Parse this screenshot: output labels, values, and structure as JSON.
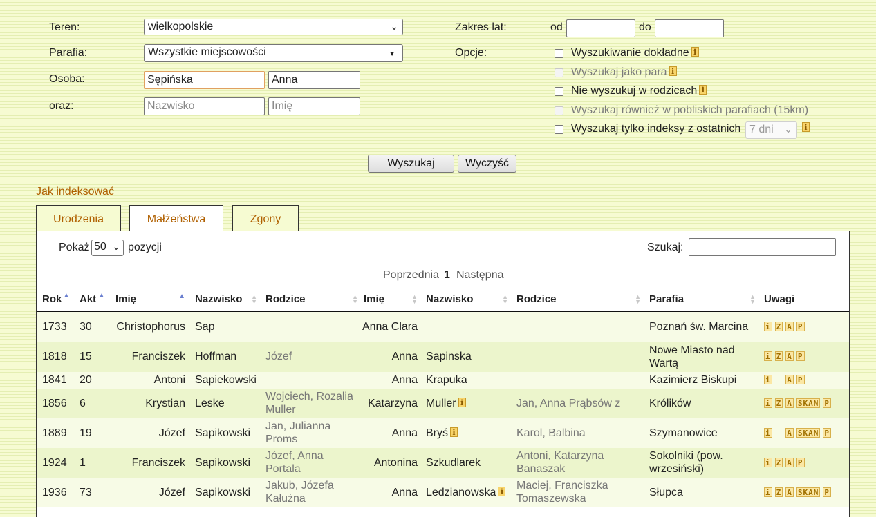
{
  "form": {
    "teren_label": "Teren:",
    "teren_value": "wielkopolskie",
    "parafia_label": "Parafia:",
    "parafia_value": "Wszystkie miejscowości",
    "osoba_label": "Osoba:",
    "osoba_surname": "Sępińska",
    "osoba_name": "Anna",
    "oraz_label": "oraz:",
    "oraz_surname_placeholder": "Nazwisko",
    "oraz_name_placeholder": "Imię",
    "zakres_label": "Zakres lat:",
    "od_label": "od",
    "do_label": "do",
    "opcje_label": "Opcje:",
    "options": [
      "Wyszukiwanie dokładne",
      "Wyszukaj jako para",
      "Nie wyszukuj w rodzicach",
      "Wyszukaj również w pobliskich parafiach (15km)",
      "Wyszukaj tylko indeksy z ostatnich"
    ],
    "days_value": "7 dni",
    "search_button": "Wyszukaj",
    "clear_button": "Wyczyść"
  },
  "how_to_index_link": "Jak indeksować",
  "tabs": [
    "Urodzenia",
    "Małżeństwa",
    "Zgony"
  ],
  "table_controls": {
    "show_label": "Pokaż",
    "page_size": "50",
    "entries_label": "pozycji",
    "search_label": "Szukaj:",
    "prev": "Poprzednia",
    "page": "1",
    "next": "Następna"
  },
  "columns": [
    "Rok",
    "Akt",
    "Imię",
    "Nazwisko",
    "Rodzice",
    "Imię",
    "Nazwisko",
    "Rodzice",
    "Parafia",
    "Uwagi"
  ],
  "icons": {
    "info": "info-icon",
    "z": "Z",
    "a": "A",
    "skan": "SKAN",
    "p": "P"
  },
  "rows": [
    {
      "rok": "1733",
      "akt": "30",
      "imie1": "Christophorus",
      "nazwisko1": "Sap",
      "rodzice1": "",
      "imie2": "Anna Clara",
      "nazwisko2": "",
      "rodzice2": "",
      "parafia": "Poznań św. Marcina"
    },
    {
      "rok": "1818",
      "akt": "15",
      "imie1": "Franciszek",
      "nazwisko1": "Hoffman",
      "rodzice1": "Józef",
      "imie2": "Anna",
      "nazwisko2": "Sapinska",
      "rodzice2": "",
      "parafia": "Nowe Miasto nad Wartą"
    },
    {
      "rok": "1841",
      "akt": "20",
      "imie1": "Antoni",
      "nazwisko1": "Sapiekowski",
      "rodzice1": "",
      "imie2": "Anna",
      "nazwisko2": "Krapuka",
      "rodzice2": "",
      "parafia": "Kazimierz Biskupi"
    },
    {
      "rok": "1856",
      "akt": "6",
      "imie1": "Krystian",
      "nazwisko1": "Leske",
      "rodzice1": "Wojciech, Rozalia Muller",
      "imie2": "Katarzyna",
      "nazwisko2": "Muller",
      "rodzice2": "Jan, Anna Prąbsów z",
      "parafia": "Królików"
    },
    {
      "rok": "1889",
      "akt": "19",
      "imie1": "Józef",
      "nazwisko1": "Sapikowski",
      "rodzice1": "Jan, Julianna Proms",
      "imie2": "Anna",
      "nazwisko2": "Bryś",
      "rodzice2": "Karol, Balbina",
      "parafia": "Szymanowice"
    },
    {
      "rok": "1924",
      "akt": "1",
      "imie1": "Franciszek",
      "nazwisko1": "Sapikowski",
      "rodzice1": "Józef, Anna Portala",
      "imie2": "Antonina",
      "nazwisko2": "Szkudlarek",
      "rodzice2": "Antoni, Katarzyna Banaszak",
      "parafia": "Sokolniki (pow. wrzesiński)"
    },
    {
      "rok": "1936",
      "akt": "73",
      "imie1": "Józef",
      "nazwisko1": "Sapikowski",
      "rodzice1": "Jakub, Józefa Kałużna",
      "imie2": "Anna",
      "nazwisko2": "Ledzianowska",
      "rodzice2": "Maciej, Franciszka Tomaszewska",
      "parafia": "Słupca"
    }
  ]
}
